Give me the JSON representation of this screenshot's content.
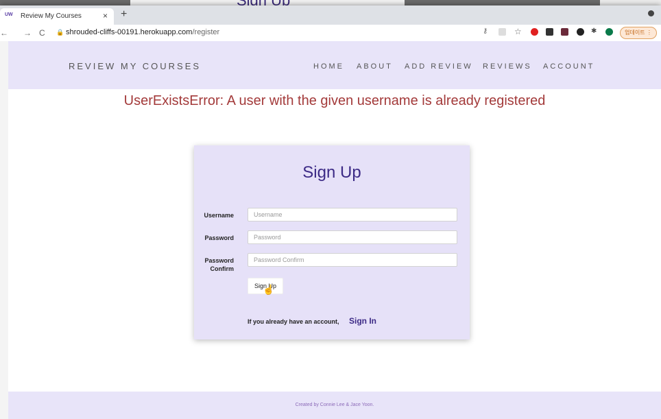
{
  "background": {
    "behind_title": "Sign Up"
  },
  "browser": {
    "tab_favicon": "UW",
    "tab_title": "Review My Courses",
    "tab_close": "×",
    "new_tab": "+",
    "back": "←",
    "forward": "→",
    "reload": "C",
    "url_host": "shrouded-cliffs-00191.herokuapp.com",
    "url_path": "/register",
    "update_label": "업데이트 ⋮"
  },
  "header": {
    "brand": "REVIEW MY COURSES",
    "nav": [
      "HOME",
      "ABOUT",
      "ADD REVIEW",
      "REVIEWS",
      "ACCOUNT"
    ]
  },
  "error_message": "UserExistsError: A user with the given username is already registered",
  "form": {
    "title": "Sign Up",
    "username_label": "Username",
    "username_placeholder": "Username",
    "password_label": "Password",
    "password_placeholder": "Password",
    "password_confirm_label_1": "Password",
    "password_confirm_label_2": "Confirm",
    "password_confirm_placeholder": "Password Confirm",
    "submit_label": "Sign Up",
    "have_account_text": "If you already have an account,",
    "signin_link": "Sign In"
  },
  "footer": {
    "text": "Created by Connie Lee & Jace Yoon."
  },
  "colors": {
    "accent": "#3c2a86",
    "header_bg": "#e8e4f9",
    "error": "#a33a3a"
  }
}
